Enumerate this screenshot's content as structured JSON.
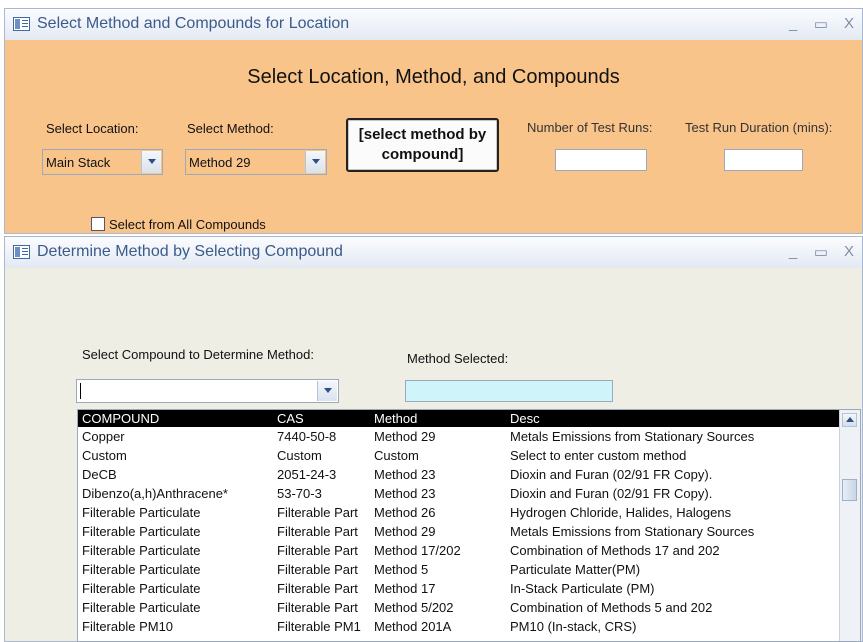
{
  "window1": {
    "title": "Select Method and Compounds for Location",
    "heading": "Select Location, Method, and Compounds",
    "location_label": "Select Location:",
    "location_value": "Main Stack",
    "method_label": "Select Method:",
    "method_value": "Method 29",
    "method_by_compound_button": "[select method by compound]",
    "test_runs_label": "Number of Test Runs:",
    "duration_label": "Test Run Duration (mins):",
    "all_compounds_label": "Select from  All Compounds",
    "controls": {
      "minimize": "_",
      "maximize": "▭",
      "close": "X"
    }
  },
  "window2": {
    "title": "Determine Method by Selecting Compound",
    "compound_label": "Select Compound to Determine Method:",
    "method_selected_label": "Method Selected:",
    "controls": {
      "minimize": "_",
      "maximize": "▭",
      "close": "X"
    },
    "list": {
      "columns": [
        "COMPOUND",
        "CAS",
        "Method",
        "Desc"
      ],
      "rows": [
        [
          "Copper",
          "7440-50-8",
          "Method 29",
          "Metals Emissions from Stationary Sources"
        ],
        [
          "Custom",
          "Custom",
          "Custom",
          "Select to enter custom method"
        ],
        [
          "DeCB",
          "2051-24-3",
          "Method 23",
          " Dioxin and Furan (02/91 FR Copy)."
        ],
        [
          "Dibenzo(a,h)Anthracene*",
          "53-70-3",
          "Method 23",
          " Dioxin and Furan (02/91 FR Copy)."
        ],
        [
          "Filterable Particulate",
          "Filterable Part",
          "Method 26",
          " Hydrogen Chloride, Halides, Halogens"
        ],
        [
          "Filterable Particulate",
          "Filterable Part",
          "Method 29",
          "Metals Emissions from Stationary Sources"
        ],
        [
          "Filterable Particulate",
          "Filterable Part",
          "Method 17/202",
          "Combination of Methods 17 and 202"
        ],
        [
          "Filterable Particulate",
          "Filterable Part",
          "Method 5",
          " Particulate Matter(PM)"
        ],
        [
          "Filterable Particulate",
          "Filterable Part",
          "Method 17",
          " In-Stack Particulate (PM)"
        ],
        [
          "Filterable Particulate",
          "Filterable Part",
          "Method 5/202",
          "Combination of Methods 5 and 202"
        ],
        [
          "Filterable PM10",
          "Filterable PM1",
          "Method 201A",
          " PM10 (In-stack, CRS)"
        ]
      ]
    }
  }
}
